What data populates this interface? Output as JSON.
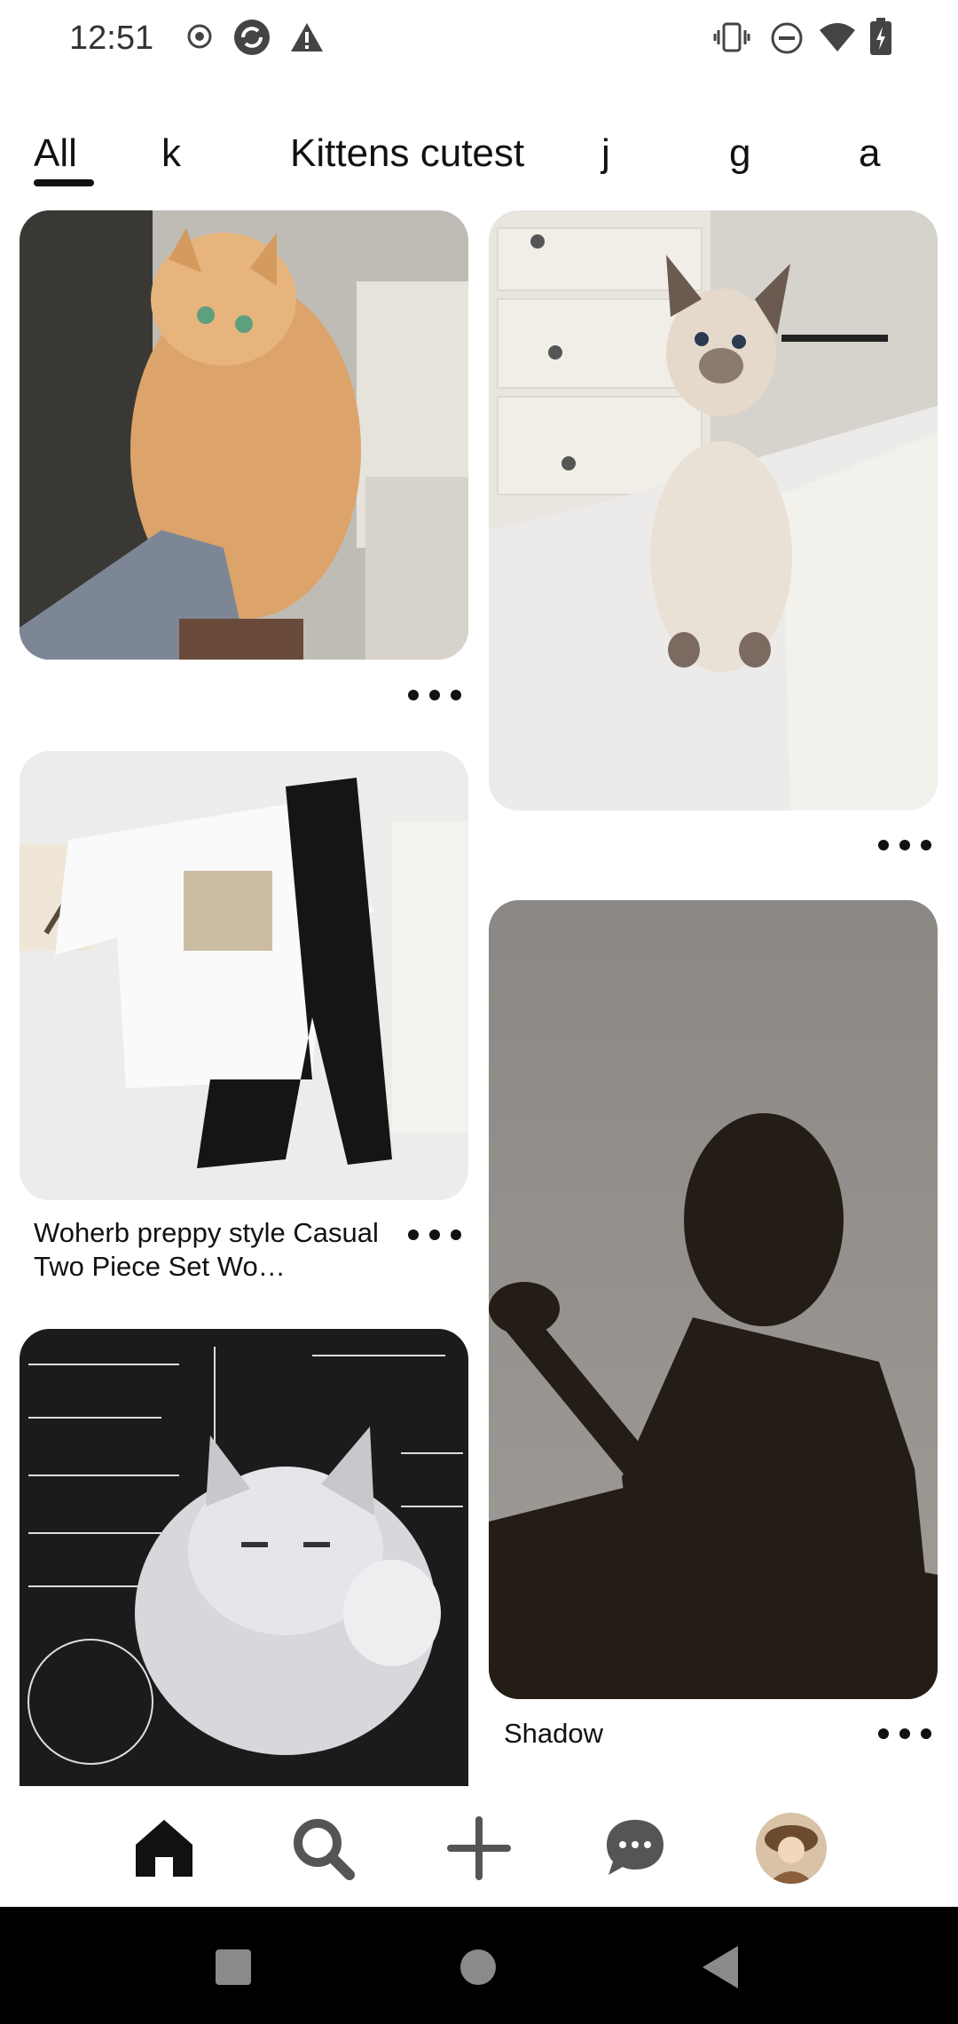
{
  "status_bar": {
    "time": "12:51",
    "left_icons": [
      "record-icon",
      "sync-icon",
      "warning-icon"
    ],
    "right_icons": [
      "vibrate-icon",
      "do-not-disturb-icon",
      "wifi-icon",
      "battery-charging-icon"
    ]
  },
  "tabs": [
    {
      "label": "All",
      "selected": true
    },
    {
      "label": "k"
    },
    {
      "label": "Kittens cutest"
    },
    {
      "label": "j"
    },
    {
      "label": "g"
    },
    {
      "label": "a"
    }
  ],
  "feed": {
    "left_column": [
      {
        "image": "fluffy-orange-cat-photo",
        "title": ""
      },
      {
        "image": "outfit-flatlay-photo",
        "title": "Woherb preppy style Casual Two Piece Set Wo…"
      },
      {
        "image": "math-cat-illustration",
        "title": ""
      }
    ],
    "right_column": [
      {
        "image": "siamese-kitten-photo",
        "title": ""
      },
      {
        "image": "guitar-shadow-photo",
        "title": "Shadow"
      }
    ]
  },
  "bottom_nav": [
    "home-icon",
    "search-icon",
    "create-plus-icon",
    "messages-icon",
    "profile-avatar"
  ],
  "colors": {
    "text": "#111111",
    "background": "#ffffff",
    "system_nav": "#000000"
  }
}
